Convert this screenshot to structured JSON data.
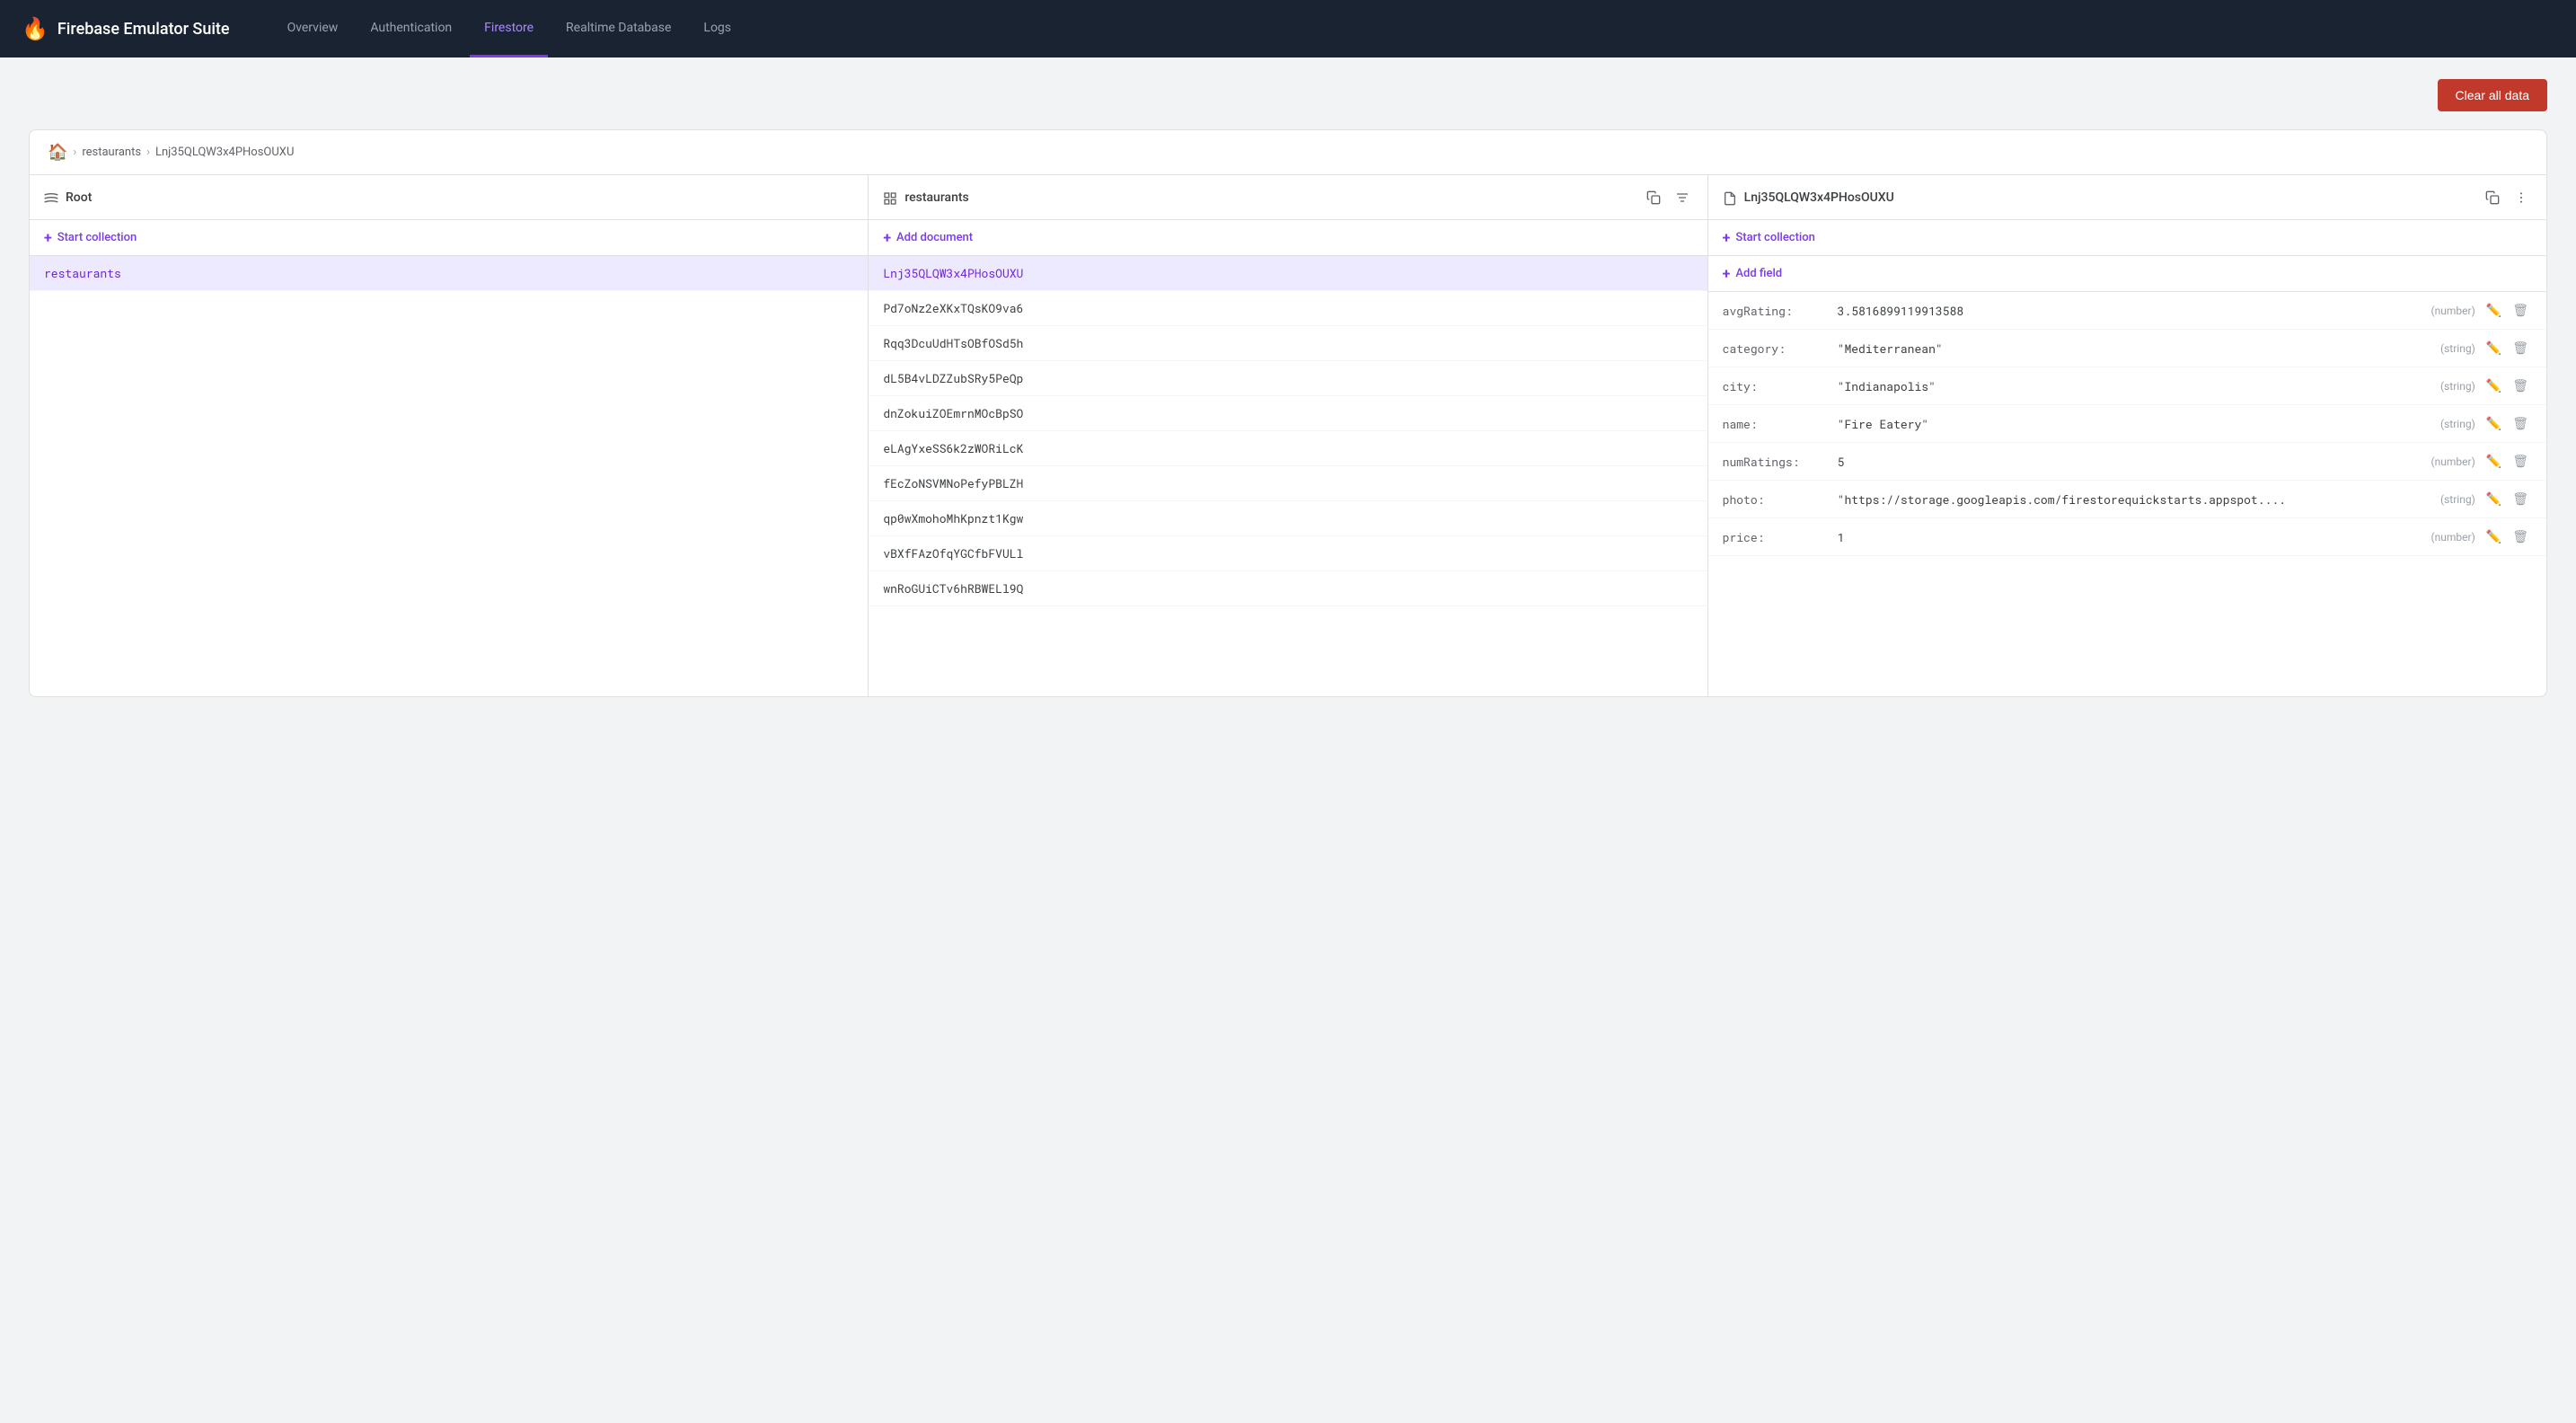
{
  "app": {
    "title": "Firebase Emulator Suite",
    "fire_icon": "🔥"
  },
  "nav": {
    "items": [
      {
        "id": "overview",
        "label": "Overview",
        "active": false
      },
      {
        "id": "authentication",
        "label": "Authentication",
        "active": false
      },
      {
        "id": "firestore",
        "label": "Firestore",
        "active": true
      },
      {
        "id": "realtime-database",
        "label": "Realtime Database",
        "active": false
      },
      {
        "id": "logs",
        "label": "Logs",
        "active": false
      }
    ]
  },
  "toolbar": {
    "clear_btn_label": "Clear all data"
  },
  "breadcrumb": {
    "home_icon": "⌂",
    "separator": "›",
    "items": [
      {
        "label": "restaurants"
      },
      {
        "label": "Lnj35QLQW3x4PHosOUXU"
      }
    ]
  },
  "columns": {
    "root": {
      "title": "Root",
      "icon": "root",
      "add_label": "Start collection",
      "items": [
        {
          "id": "restaurants",
          "label": "restaurants",
          "selected": true
        }
      ]
    },
    "restaurants": {
      "title": "restaurants",
      "icon": "collection",
      "add_label": "Add document",
      "items": [
        {
          "id": "lnj35",
          "label": "Lnj35QLQW3x4PHosOUXU",
          "selected": true
        },
        {
          "id": "pd7",
          "label": "Pd7oNz2eXKxTQsKO9va6",
          "selected": false
        },
        {
          "id": "rqq",
          "label": "Rqq3DcuUdHTsOBfOSd5h",
          "selected": false
        },
        {
          "id": "dl5",
          "label": "dL5B4vLDZZubSRy5PeQp",
          "selected": false
        },
        {
          "id": "dnz",
          "label": "dnZokuiZOEmrnMOcBpSO",
          "selected": false
        },
        {
          "id": "ela",
          "label": "eLAgYxeSS6k2zWORiLcK",
          "selected": false
        },
        {
          "id": "fec",
          "label": "fEcZoNSVMNoPefyPBLZH",
          "selected": false
        },
        {
          "id": "qp0",
          "label": "qp0wXmohoMhKpnzt1Kgw",
          "selected": false
        },
        {
          "id": "vbx",
          "label": "vBXfFAzOfqYGCfbFVULl",
          "selected": false
        },
        {
          "id": "wnr",
          "label": "wnRoGUiCTv6hRBWELl9Q",
          "selected": false
        }
      ]
    },
    "document": {
      "title": "Lnj35QLQW3x4PHosOUXU",
      "icon": "document",
      "start_collection_label": "Start collection",
      "add_field_label": "Add field",
      "fields": [
        {
          "key": "avgRating:",
          "value": "3.5816899119913588",
          "type": "(number)"
        },
        {
          "key": "category:",
          "value": "\"Mediterranean\"",
          "type": "(string)"
        },
        {
          "key": "city:",
          "value": "\"Indianapolis\"",
          "type": "(string)"
        },
        {
          "key": "name:",
          "value": "\"Fire Eatery\"",
          "type": "(string)"
        },
        {
          "key": "numRatings:",
          "value": "5",
          "type": "(number)"
        },
        {
          "key": "photo:",
          "value": "\"https://storage.googleapis.com/firestorequickstarts.appspot....",
          "type": "(string)"
        },
        {
          "key": "price:",
          "value": "1",
          "type": "(number)"
        }
      ]
    }
  }
}
